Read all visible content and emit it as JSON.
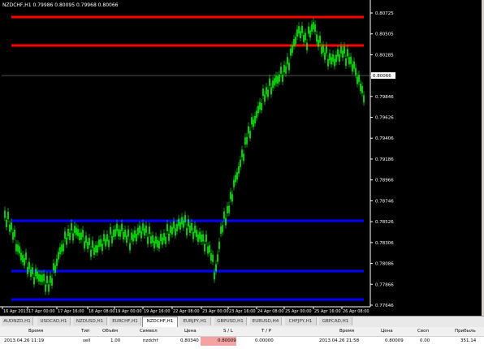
{
  "chart": {
    "header": "NZDCHF,H1  0.79986 0.80095 0.79968 0.80066",
    "current_price": "0.80066",
    "price_axis": [
      "0.80725",
      "0.80505",
      "0.80285",
      "0.80066",
      "0.79846",
      "0.79626",
      "0.79406",
      "0.79186",
      "0.78966",
      "0.78746",
      "0.78526",
      "0.78306",
      "0.78086",
      "0.77866",
      "0.77646"
    ],
    "time_axis": [
      "16 Apr 2013",
      "17 Apr 00:00",
      "17 Apr 16:00",
      "18 Apr 08:00",
      "19 Apr 00:00",
      "19 Apr 16:00",
      "22 Apr 08:00",
      "23 Apr 00:00",
      "23 Apr 16:00",
      "24 Apr 08:00",
      "25 Apr 00:00",
      "25 Apr 16:00",
      "26 Apr 08:00"
    ],
    "colors": {
      "background": "#000000",
      "candle": "#00ff00",
      "resistance": "#ff0000",
      "support": "#0000ff",
      "grid": "#1e4d1e"
    }
  },
  "tabs": [
    "AUDNZD,H1",
    "USDCAD,H1",
    "NZDUSD,H1",
    "EURCHF,H1",
    "NZDCHF,H1",
    "EURJPY,H1",
    "GBPUSD,H1",
    "EURUSD,H4",
    "CHFJPY,H1",
    "GBPCAD,H1"
  ],
  "active_tab": "NZDCHF,H1",
  "terminal": {
    "headers": {
      "time": "Время",
      "type": "Тип",
      "volume": "Объём",
      "symbol": "Символ",
      "price": "Цена",
      "sl": "S / L",
      "tp": "T / P",
      "close_time": "Время",
      "close_price": "Цена",
      "swap": "Своп",
      "profit": "Прибыль"
    },
    "row": {
      "time": "2013.04.26 11:19",
      "type": "sell",
      "volume": "1.00",
      "symbol": "nzdchf",
      "price": "0.80340",
      "sl": "0.80009",
      "tp": "0.00000",
      "close_time": "2013.04.26 21:58",
      "close_price": "0.80009",
      "swap": "0.00",
      "profit": "351.14"
    }
  }
}
